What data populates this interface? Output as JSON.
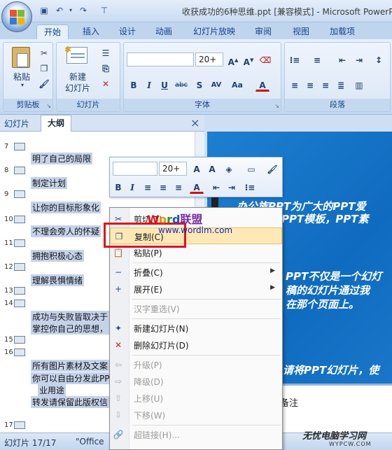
{
  "window": {
    "title": "收获成功的6种思维.ppt [兼容模式] - Microsoft PowerPoint"
  },
  "tabs": [
    "开始",
    "插入",
    "设计",
    "动画",
    "幻灯片放映",
    "审阅",
    "视图",
    "加载项"
  ],
  "ribbon": {
    "clipboard": {
      "label": "剪贴板",
      "paste": "粘贴"
    },
    "slides": {
      "label": "幻灯片",
      "new_slide_l1": "新建",
      "new_slide_l2": "幻灯片"
    },
    "font": {
      "label": "字体",
      "size": "20+"
    },
    "paragraph": {
      "label": "段落"
    }
  },
  "pane": {
    "tab_slides": "幻灯片",
    "tab_outline": "大纲",
    "close": "×"
  },
  "outline": {
    "items": [
      {
        "num": "7",
        "text": "明了自己的局限"
      },
      {
        "num": "8",
        "text": "制定计划"
      },
      {
        "num": "9",
        "text": "让你的目标形象化"
      },
      {
        "num": "10",
        "text": "不理会旁人的怀疑"
      },
      {
        "num": "11",
        "text": "拥抱积极心态"
      },
      {
        "num": "12",
        "text": "理解畏惧情绪"
      },
      {
        "num": "13",
        "text": ""
      },
      {
        "num": "14",
        "text": "成功与失败皆取决于"
      },
      {
        "num": "",
        "text": "掌控你自己的思想，"
      },
      {
        "num": "15",
        "text": ""
      },
      {
        "num": "16",
        "text": "所有图片素材及文案"
      },
      {
        "num": "",
        "text": "你可以自由分发此PP"
      },
      {
        "num": "",
        "text": "业用途"
      },
      {
        "num": "",
        "text": "转发请保留此版权信"
      },
      {
        "num": "17",
        "text": ""
      }
    ]
  },
  "slide": {
    "lines": [
      "办公族PPT为广大的PPT爱",
      "PPT模板，PPT素",
      "PPT不仅是一个幻灯",
      "稿的幻灯片通过我",
      "在那个页面上。",
      "请将PPT幻灯片，使"
    ],
    "notes": "备注"
  },
  "mini_toolbar": {
    "font_size": "20+"
  },
  "context_menu": {
    "items": [
      {
        "label": "剪切(T)",
        "icon": "scissors-icon",
        "disabled": false
      },
      {
        "label": "复制(C)",
        "icon": "copy-icon",
        "disabled": false
      },
      {
        "label": "粘贴(P)",
        "icon": "paste-icon",
        "disabled": false
      },
      {
        "label": "折叠(C)",
        "icon": "collapse-icon",
        "disabled": false,
        "submenu": true
      },
      {
        "label": "展开(E)",
        "icon": "expand-icon",
        "disabled": false,
        "submenu": true
      },
      {
        "label": "汉字重选(V)",
        "icon": "",
        "disabled": true
      },
      {
        "label": "新建幻灯片(N)",
        "icon": "new-slide-icon",
        "disabled": false
      },
      {
        "label": "删除幻灯片(D)",
        "icon": "delete-slide-icon",
        "disabled": false
      },
      {
        "label": "升级(P)",
        "icon": "promote-icon",
        "disabled": true
      },
      {
        "label": "降级(D)",
        "icon": "demote-icon",
        "disabled": true
      },
      {
        "label": "上移(U)",
        "icon": "move-up-icon",
        "disabled": true
      },
      {
        "label": "下移(W)",
        "icon": "move-down-icon",
        "disabled": true
      },
      {
        "label": "超链接(H)...",
        "icon": "hyperlink-icon",
        "disabled": true
      }
    ]
  },
  "watermark": {
    "brand_w": "W",
    "brand_o": "o",
    "brand_r": "r",
    "brand_d": "d",
    "brand_cn": "联盟",
    "url": "www.wordlm.com"
  },
  "status": {
    "slide": "幻灯片 17/17",
    "theme": "\"Office"
  },
  "footer": {
    "logo": "无忧电脑学习网",
    "url": "WYPCW.COM"
  },
  "colors": {
    "highlight": "#e0111a",
    "slide_bg": "#1272c4"
  }
}
